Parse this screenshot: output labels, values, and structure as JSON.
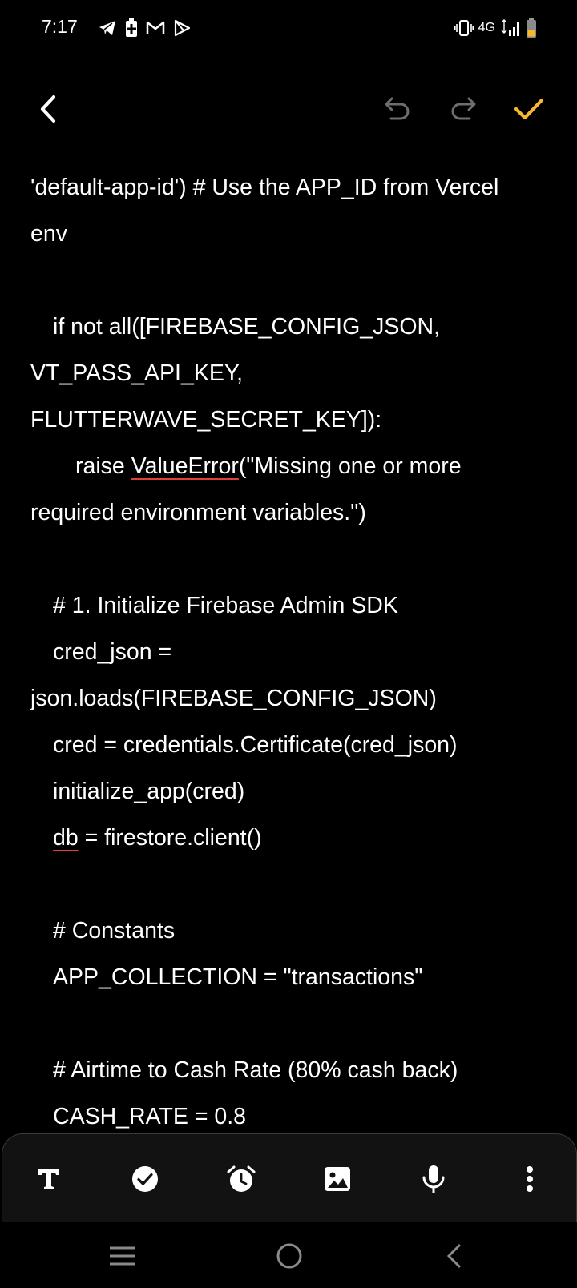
{
  "status_bar": {
    "time": "7:17",
    "network": "4G",
    "left_icons": [
      "telegram-icon",
      "battery-saver-icon",
      "gmail-icon",
      "play-icon"
    ],
    "right_icons": [
      "vibrate-icon",
      "signal-icon",
      "battery-icon"
    ]
  },
  "top_bar": {
    "back_icon": "chevron-left-icon",
    "undo_icon": "undo-icon",
    "redo_icon": "redo-icon",
    "save_icon": "check-icon",
    "accent_color": "#f5b82e"
  },
  "editor": {
    "lines": [
      {
        "text": "'default-app-id') # Use the APP_ID from Vercel",
        "indent": 0
      },
      {
        "text": "env",
        "indent": 0
      },
      {
        "text": "",
        "indent": 0
      },
      {
        "text": "if not all([FIREBASE_CONFIG_JSON,",
        "indent": 1
      },
      {
        "text": "VT_PASS_API_KEY,",
        "indent": 0
      },
      {
        "text": "FLUTTERWAVE_SECRET_KEY]):",
        "indent": 0
      },
      {
        "before": "raise ",
        "misspelled": "ValueError",
        "after": "(\"Missing one or more",
        "indent": 2
      },
      {
        "text": "required environment variables.\")",
        "indent": 0
      },
      {
        "text": "",
        "indent": 0
      },
      {
        "text": "# 1. Initialize Firebase Admin SDK",
        "indent": 1
      },
      {
        "text": "cred_json =",
        "indent": 1
      },
      {
        "text": "json.loads(FIREBASE_CONFIG_JSON)",
        "indent": 0
      },
      {
        "text": "cred = credentials.Certificate(cred_json)",
        "indent": 1
      },
      {
        "text": "initialize_app(cred)",
        "indent": 1
      },
      {
        "before": "",
        "misspelled": "db",
        "after": " = firestore.client()",
        "indent": 1
      },
      {
        "text": "",
        "indent": 0
      },
      {
        "text": "# Constants",
        "indent": 1
      },
      {
        "text": "APP_COLLECTION = \"transactions\"",
        "indent": 1
      },
      {
        "text": "",
        "indent": 0
      },
      {
        "text": "# Airtime to Cash Rate (80% cash back)",
        "indent": 1
      },
      {
        "text": "CASH_RATE = 0.8",
        "indent": 1
      }
    ],
    "spellcheck_color": "#e0403a"
  },
  "format_bar": {
    "buttons": [
      "text-format-icon",
      "checkbox-icon",
      "alarm-icon",
      "image-icon",
      "microphone-icon",
      "more-vertical-icon"
    ]
  },
  "nav_bar": {
    "buttons": [
      "recent-apps-icon",
      "home-icon",
      "back-icon"
    ]
  }
}
